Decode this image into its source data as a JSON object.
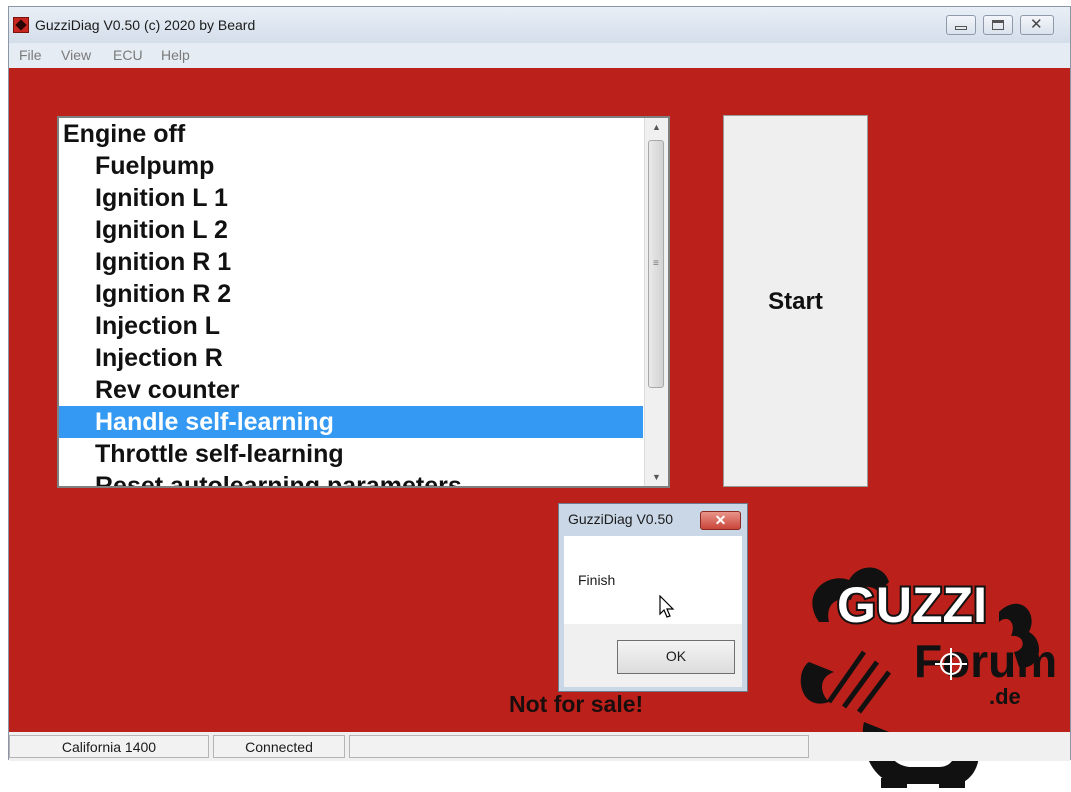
{
  "window": {
    "title": "GuzziDiag V0.50  (c) 2020 by Beard"
  },
  "menu": {
    "items": [
      {
        "label": "File"
      },
      {
        "label": "View"
      },
      {
        "label": "ECU"
      },
      {
        "label": "Help"
      }
    ]
  },
  "list": {
    "items": [
      {
        "label": "Engine off"
      },
      {
        "label": "Fuelpump"
      },
      {
        "label": "Ignition L 1"
      },
      {
        "label": "Ignition L 2"
      },
      {
        "label": "Ignition R 1"
      },
      {
        "label": "Ignition R 2"
      },
      {
        "label": "Injection L"
      },
      {
        "label": "Injection R"
      },
      {
        "label": "Rev counter"
      },
      {
        "label": "Handle self-learning"
      },
      {
        "label": "Throttle self-learning"
      },
      {
        "label": "Reset autolearning parameters"
      }
    ],
    "selected_label": "Handle self-learning"
  },
  "start_button": {
    "label": "Start"
  },
  "dialog": {
    "title": "GuzziDiag V0.50",
    "message": "Finish",
    "ok_label": "OK"
  },
  "notice": {
    "text": "Not for sale!"
  },
  "logo": {
    "line1": "GUZZI",
    "line2": "Forum",
    "line3": ".de"
  },
  "statusbar": {
    "model": "California 1400",
    "connection": "Connected"
  },
  "colors": {
    "background": "#bb211a",
    "selection": "#3399f3"
  }
}
